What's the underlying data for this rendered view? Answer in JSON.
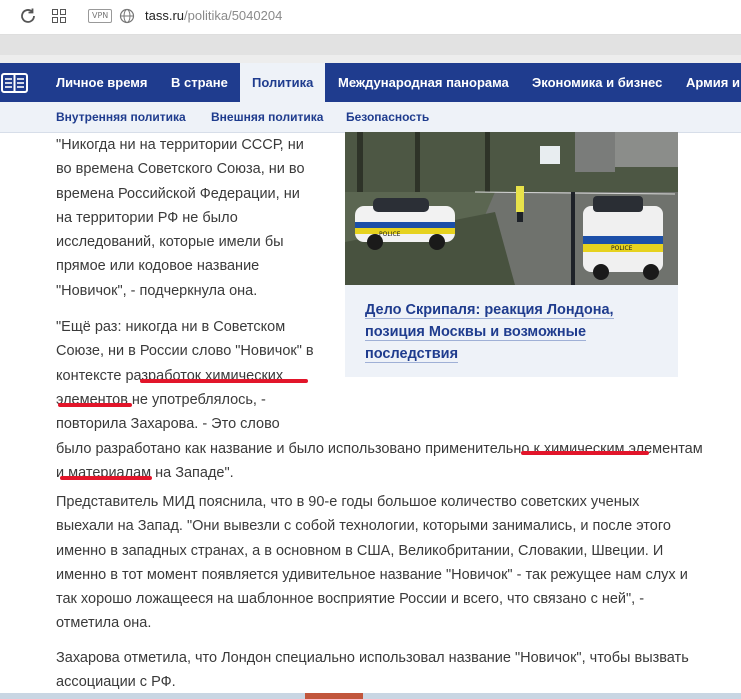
{
  "browser": {
    "vpn_badge": "VPN",
    "url_host": "tass.ru",
    "url_path": "/politika/5040204",
    "icons": [
      "reload-icon",
      "tabs-grid-icon",
      "globe-icon"
    ]
  },
  "nav": {
    "items": [
      "Личное время",
      "В стране",
      "Политика",
      "Международная панорама",
      "Экономика и бизнес",
      "Армия и"
    ],
    "active": "Политика",
    "brand_color": "#1f3c8e"
  },
  "subnav": {
    "items": [
      "Внутренняя политика",
      "Внешняя политика",
      "Безопасность"
    ]
  },
  "article": {
    "p1": "\"Никогда ни на территории СССР, ни во времена Советского Союза, ни во времена Российской Федерации, ни на территории РФ не было исследований, которые имели бы прямое или кодовое название \"Новичок\", - подчеркнула она.",
    "p2": "\"Ещё раз: никогда ни в Советском Союзе, ни в России слово \"Новичок\" в контексте разработок химических элементов не употреблялось, - повторила Захарова. - Это слово",
    "p2b": "было разработано как название и было использовано применительно к химическим элементам и материалам на Западе\".",
    "p3": "Представитель МИД пояснила, что в 90-е годы большое количество советских ученых выехали на Запад. \"Они вывезли с собой технологии, которыми занимались, и после этого именно в западных странах, а в основном в США, Великобритании, Словакии, Швеции. И именно в тот момент появляется удивительное название \"Новичок\" - так режущее нам слух и так хорошо ложащееся на шаблонное восприятие России и всего, что связано с ней\", - отметила она.",
    "p4": "Захарова отметила, что Лондон специально использовал название \"Новичок\", чтобы вызвать ассоциации с РФ."
  },
  "related": {
    "title": "Дело Скрипаля: реакция Лондона, позиция Москвы и возможные последствия",
    "police_label": "POLICE"
  },
  "highlight_color": "#e2152a"
}
